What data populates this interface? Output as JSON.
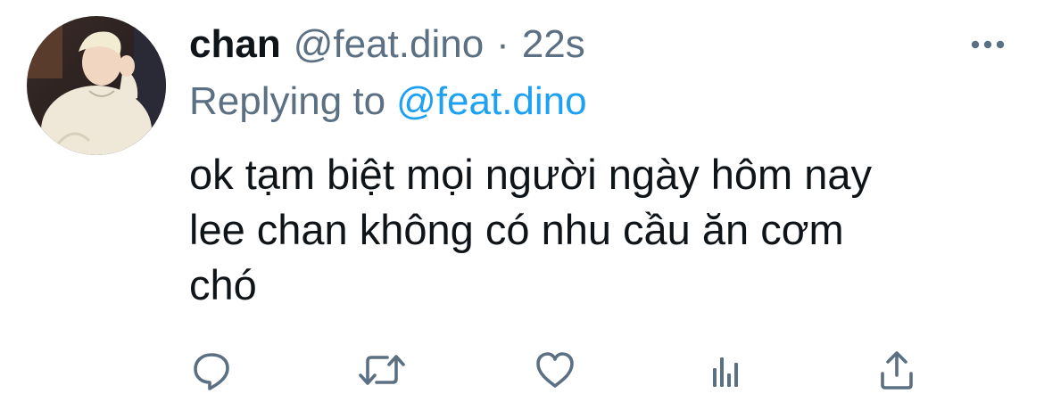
{
  "tweet": {
    "display_name": "chan",
    "handle": "@feat.dino",
    "separator": "·",
    "time": "22s",
    "reply_prefix": "Replying to",
    "reply_handle": "@feat.dino",
    "text_lines": [
      "ok tạm biệt mọi người ngày hôm nay",
      "lee chan không có nhu cầu ăn cơm",
      "chó"
    ]
  },
  "icons": {
    "more": "more-horizontal-icon",
    "reply": "reply-icon",
    "retweet": "retweet-icon",
    "like": "heart-icon",
    "analytics": "analytics-icon",
    "share": "share-icon"
  },
  "colors": {
    "text": "#0f1419",
    "secondary": "#5b7083",
    "link": "#1da1f2",
    "background": "#ffffff"
  }
}
